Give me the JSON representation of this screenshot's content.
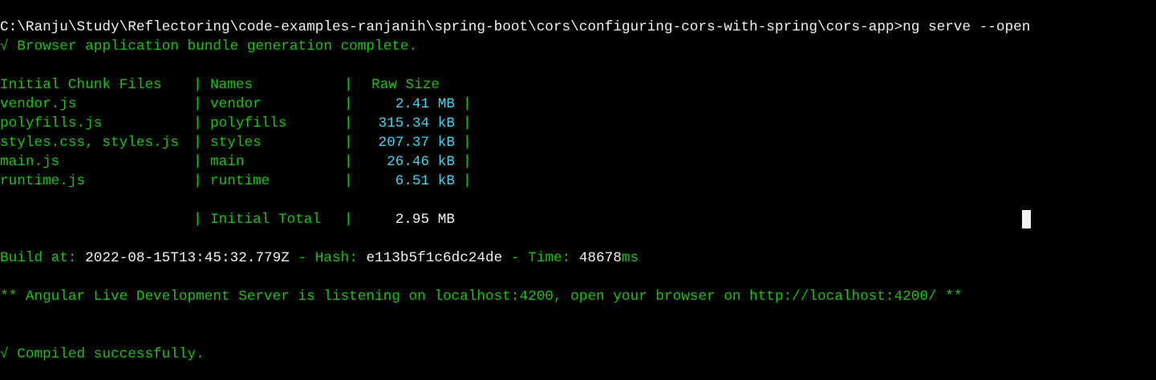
{
  "prompt": {
    "path": "C:\\Ranju\\Study\\Reflectoring\\code-examples-ranjanih\\spring-boot\\cors\\configuring-cors-with-spring\\cors-app>",
    "command": "ng serve --open"
  },
  "bundle_message": "√ Browser application bundle generation complete.",
  "table": {
    "headers": [
      "Initial Chunk Files",
      "Names",
      "Raw Size"
    ],
    "rows": [
      {
        "file": "vendor.js",
        "name": "vendor",
        "size": "2.41 MB"
      },
      {
        "file": "polyfills.js",
        "name": "polyfills",
        "size": "315.34 kB"
      },
      {
        "file": "styles.css, styles.js",
        "name": "styles",
        "size": "207.37 kB"
      },
      {
        "file": "main.js",
        "name": "main",
        "size": "26.46 kB"
      },
      {
        "file": "runtime.js",
        "name": "runtime",
        "size": "6.51 kB"
      }
    ],
    "total_label": "Initial Total",
    "total_size": "2.95 MB"
  },
  "build": {
    "label": "Build at: ",
    "timestamp": "2022-08-15T13:45:32.779Z",
    "hash_sep": " - Hash: ",
    "hash": "e113b5f1c6dc24de",
    "time_sep": " - Time: ",
    "time": "48678",
    "time_unit": "ms"
  },
  "server_message": "** Angular Live Development Server is listening on localhost:4200, open your browser on http://localhost:4200/ **",
  "compiled_message": "√ Compiled successfully.",
  "colors": {
    "background": "#000000",
    "green": "#16c60c",
    "white": "#f2f2f2",
    "cyan": "#3bd6f0"
  }
}
